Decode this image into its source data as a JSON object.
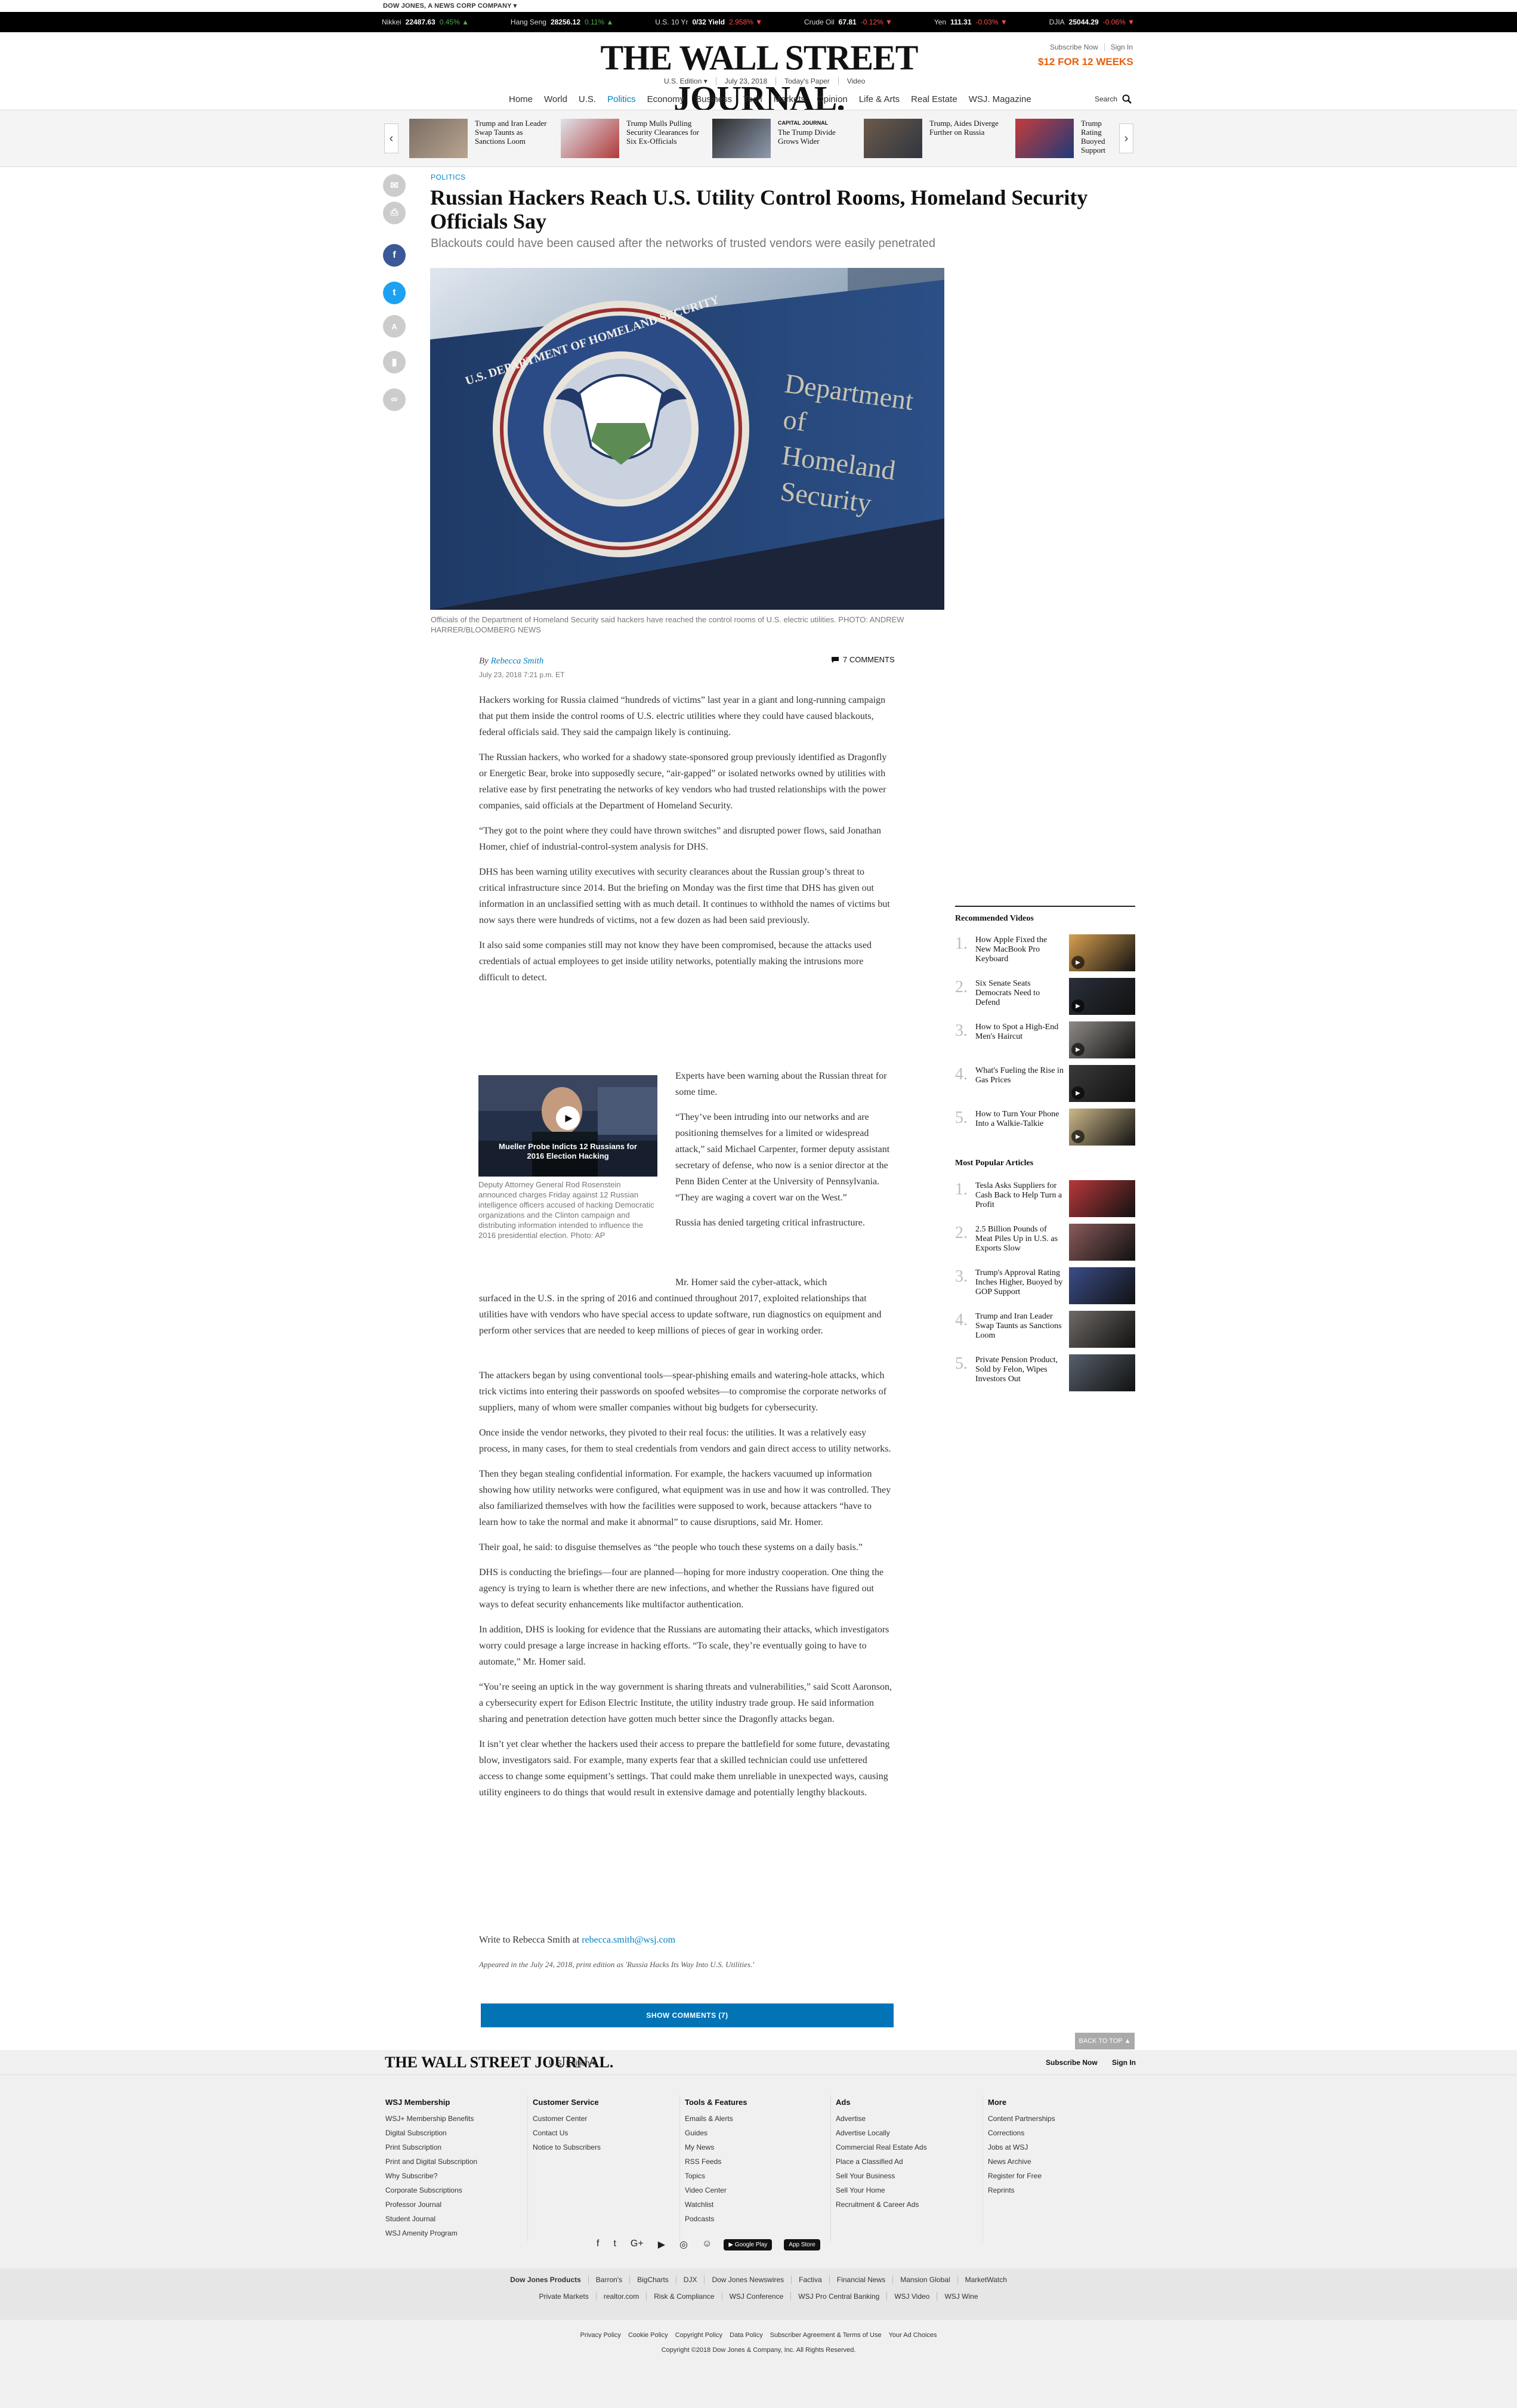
{
  "corp_bar": "DOW JONES, A NEWS CORP COMPANY ▾",
  "ticker": [
    {
      "name": "Nikkei",
      "value": "22487.63",
      "change": "0.45% ▲",
      "dir": "up"
    },
    {
      "name": "Hang Seng",
      "value": "28256.12",
      "change": "0.11% ▲",
      "dir": "up"
    },
    {
      "name": "U.S. 10 Yr",
      "value": "0/32 Yield",
      "change": "2.958% ▼",
      "dir": "dn"
    },
    {
      "name": "Crude Oil",
      "value": "67.81",
      "change": "-0.12% ▼",
      "dir": "dn"
    },
    {
      "name": "Yen",
      "value": "111.31",
      "change": "-0.03% ▼",
      "dir": "dn"
    },
    {
      "name": "DJIA",
      "value": "25044.29",
      "change": "-0.06% ▼",
      "dir": "dn"
    }
  ],
  "masthead": {
    "logo": "THE WALL STREET JOURNAL.",
    "edition": "U.S. Edition ▾",
    "date": "July 23, 2018",
    "todays_paper": "Today's Paper",
    "video": "Video",
    "subscribe_now": "Subscribe Now",
    "sign_in": "Sign In",
    "offer": "$12 FOR 12 WEEKS"
  },
  "nav": {
    "items": [
      "Home",
      "World",
      "U.S.",
      "Politics",
      "Economy",
      "Business",
      "Tech",
      "Markets",
      "Opinion",
      "Life & Arts",
      "Real Estate",
      "WSJ. Magazine"
    ],
    "active": "Politics",
    "search_label": "Search"
  },
  "strip": [
    {
      "tag": "",
      "title": "Trump and Iran Leader Swap Taunts as Sanctions Loom"
    },
    {
      "tag": "",
      "title": "Trump Mulls Pulling Security Clearances for Six Ex-Officials"
    },
    {
      "tag": "CAPITAL JOURNAL",
      "title": "The Trump Divide Grows Wider"
    },
    {
      "tag": "",
      "title": "Trump, Aides Diverge Further on Russia"
    },
    {
      "tag": "",
      "title": "Trump Rating Buoyed Support"
    }
  ],
  "article": {
    "section": "POLITICS",
    "headline": "Russian Hackers Reach U.S. Utility Control Rooms, Homeland Security Officials Say",
    "dek": "Blackouts could have been caused after the networks of trusted vendors were easily penetrated",
    "hero_caption": "Officials of the Department of Homeland Security said hackers have reached the control rooms of U.S. electric utilities. PHOTO: ANDREW HARRER/BLOOMBERG NEWS",
    "seal_text": "U.S. DEPARTMENT OF HOMELAND SECURITY",
    "sign_text": [
      "Department",
      "of",
      "Homeland",
      "Security"
    ],
    "by": "By",
    "author": "Rebecca Smith",
    "date": "July 23, 2018 7:21 p.m. ET",
    "comments": "7 COMMENTS",
    "paragraphs": [
      "Hackers working for Russia claimed “hundreds of victims” last year in a giant and long-running campaign that put them inside the control rooms of U.S. electric utilities where they could have caused blackouts, federal officials said. They said the campaign likely is continuing.",
      "The Russian hackers, who worked for a shadowy state-sponsored group previously identified as Dragonfly or Energetic Bear, broke into supposedly secure, “air-gapped” or isolated networks owned by utilities with relative ease by first penetrating the networks of key vendors who had trusted relationships with the power companies, said officials at the Department of Homeland Security.",
      "“They got to the point where they could have thrown switches” and disrupted power flows, said Jonathan Homer, chief of industrial-control-system analysis for DHS.",
      "DHS has been warning utility executives with security clearances about the Russian group’s threat to critical infrastructure since 2014. But the briefing on Monday was the first time that DHS has given out information in an unclassified setting with as much detail. It continues to withhold the names of victims but now says there were hundreds of victims, not a few dozen as had been said previously.",
      "It also said some companies still may not know they have been compromised, because the attacks used credentials of actual employees to get inside utility networks, potentially making the intrusions more difficult to detect."
    ],
    "video": {
      "title": "Mueller Probe Indicts 12 Russians for 2016 Election Hacking",
      "caption": "Deputy Attorney General Rod Rosenstein announced charges Friday against 12 Russian intelligence officers accused of hacking Democratic organizations and the Clinton campaign and distributing information intended to influence the 2016 presidential election. Photo: AP"
    },
    "side_paragraphs": [
      "Experts have been warning about the Russian threat for some time.",
      "“They’ve been intruding into our networks and are positioning themselves for a limited or widespread attack,” said Michael Carpenter, former deputy assistant secretary of defense, who now is a senior director at the Penn Biden Center at the University of Pennsylvania. “They are waging a covert war on the West.”",
      "Russia has denied targeting critical infrastructure."
    ],
    "homer_lead": "Mr. Homer said the cyber-attack, which",
    "homer_rest": "surfaced in the U.S. in the spring of 2016 and continued throughout 2017, exploited relationships that utilities have with vendors who have special access to update software, run diagnostics on equipment and perform other services that are needed to keep millions of pieces of gear in working order.",
    "paragraphs2": [
      "The attackers began by using conventional tools—spear-phishing emails and watering-hole attacks, which trick victims into entering their passwords on spoofed websites—to compromise the corporate networks of suppliers, many of whom were smaller companies without big budgets for cybersecurity.",
      "Once inside the vendor networks, they pivoted to their real focus: the utilities. It was a relatively easy process, in many cases, for them to steal credentials from vendors and gain direct access to utility networks.",
      "Then they began stealing confidential information. For example, the hackers vacuumed up information showing how utility networks were configured, what equipment was in use and how it was controlled. They also familiarized themselves with how the facilities were supposed to work, because attackers “have to learn how to take the normal and make it abnormal” to cause disruptions, said Mr. Homer.",
      "Their goal, he said: to disguise themselves as “the people who touch these systems on a daily basis.”",
      "DHS is conducting the briefings—four are planned—hoping for more industry cooperation. One thing the agency is trying to learn is whether there are new infections, and whether the Russians have figured out ways to defeat security enhancements like multifactor authentication.",
      "In addition, DHS is looking for evidence that the Russians are automating their attacks, which investigators worry could presage a large increase in hacking efforts. “To scale, they’re eventually going to have to automate,” Mr. Homer said.",
      "“You’re seeing an uptick in the way government is sharing threats and vulnerabilities,” said Scott Aaronson, a cybersecurity expert for Edison Electric Institute, the utility industry trade group. He said information sharing and penetration detection have gotten much better since the Dragonfly attacks began.",
      "It isn’t yet clear whether the hackers used their access to prepare the battlefield for some future, devastating blow, investigators said. For example, many experts fear that a skilled technician could use unfettered access to change some equipment’s settings. That could make them unreliable in unexpected ways, causing utility engineers to do things that would result in extensive damage and potentially lengthy blackouts."
    ],
    "write_to": "Write to Rebecca Smith at",
    "email": "rebecca.smith@wsj.com",
    "appeared": "Appeared in the July 24, 2018, print edition as 'Russia Hacks Its Way Into U.S. Utilities.'",
    "show_comments": "SHOW COMMENTS (7)"
  },
  "sidebar": {
    "videos_title": "Recommended Videos",
    "videos": [
      {
        "num": "1.",
        "title": "How Apple Fixed the New MacBook Pro Keyboard"
      },
      {
        "num": "2.",
        "title": "Six Senate Seats Democrats Need to Defend"
      },
      {
        "num": "3.",
        "title": "How to Spot a High-End Men's Haircut"
      },
      {
        "num": "4.",
        "title": "What's Fueling the Rise in Gas Prices"
      },
      {
        "num": "5.",
        "title": "How to Turn Your Phone Into a Walkie-Talkie"
      }
    ],
    "popular_title": "Most Popular Articles",
    "popular": [
      {
        "num": "1.",
        "title": "Tesla Asks Suppliers for Cash Back to Help Turn a Profit"
      },
      {
        "num": "2.",
        "title": "2.5 Billion Pounds of Meat Piles Up in U.S. as Exports Slow"
      },
      {
        "num": "3.",
        "title": "Trump's Approval Rating Inches Higher, Buoyed by GOP Support"
      },
      {
        "num": "4.",
        "title": "Trump and Iran Leader Swap Taunts as Sanctions Loom"
      },
      {
        "num": "5.",
        "title": "Private Pension Product, Sold by Felon, Wipes Investors Out"
      }
    ]
  },
  "footer": {
    "back_to_top": "BACK TO TOP ▲",
    "logo": "THE WALL STREET JOURNAL.",
    "edition": "U.S. Edition ▾",
    "subscribe_now": "Subscribe Now",
    "sign_in": "Sign In",
    "columns": [
      {
        "title": "WSJ Membership",
        "links": [
          "WSJ+ Membership Benefits",
          "Digital Subscription",
          "Print Subscription",
          "Print and Digital Subscription",
          "Why Subscribe?",
          "Corporate Subscriptions",
          "Professor Journal",
          "Student Journal",
          "WSJ Amenity Program"
        ]
      },
      {
        "title": "Customer Service",
        "links": [
          "Customer Center",
          "Contact Us",
          "Notice to Subscribers"
        ]
      },
      {
        "title": "Tools & Features",
        "links": [
          "Emails & Alerts",
          "Guides",
          "My News",
          "RSS Feeds",
          "Topics",
          "Video Center",
          "Watchlist",
          "Podcasts"
        ]
      },
      {
        "title": "Ads",
        "links": [
          "Advertise",
          "Advertise Locally",
          "Commercial Real Estate Ads",
          "Place a Classified Ad",
          "Sell Your Business",
          "Sell Your Home",
          "Recruitment & Career Ads"
        ]
      },
      {
        "title": "More",
        "links": [
          "Content Partnerships",
          "Corrections",
          "Jobs at WSJ",
          "News Archive",
          "Register for Free",
          "Reprints"
        ]
      }
    ],
    "social_icons": [
      "f",
      "t",
      "G+",
      "▶",
      "◎",
      "☺"
    ],
    "google_play": "▶ Google Play",
    "app_store": " App Store",
    "products_row1": [
      "Dow Jones Products",
      "Barron's",
      "BigCharts",
      "DJX",
      "Dow Jones Newswires",
      "Factiva",
      "Financial News",
      "Mansion Global",
      "MarketWatch"
    ],
    "products_row2": [
      "Private Markets",
      "realtor.com",
      "Risk & Compliance",
      "WSJ Conference",
      "WSJ Pro Central Banking",
      "WSJ Video",
      "WSJ Wine"
    ],
    "legal": [
      "Privacy Policy",
      "Cookie Policy",
      "Copyright Policy",
      "Data Policy",
      "Subscriber Agreement & Terms of Use",
      "Your Ad Choices"
    ],
    "copyright": "Copyright ©2018 Dow Jones & Company, Inc. All Rights Reserved."
  },
  "colors": {
    "accent": "#0080c3",
    "offer": "#e85d0a",
    "button": "#0274b6"
  }
}
